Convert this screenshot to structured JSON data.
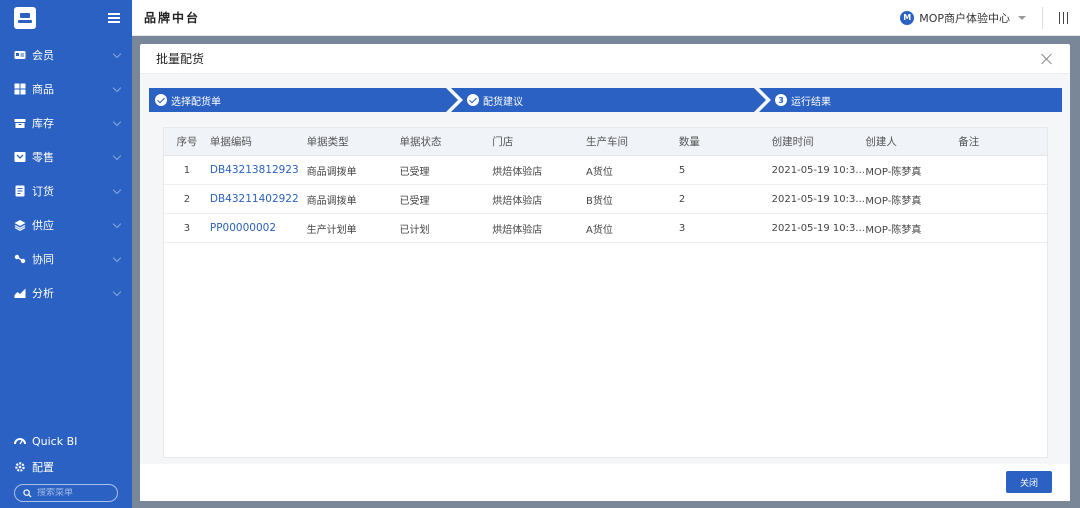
{
  "colors": {
    "primary": "#2a61c2",
    "overlay": "#7a8799"
  },
  "sidebar": {
    "logo_icon": "brand-logo-icon",
    "items": [
      {
        "label": "会员",
        "icon": "member-card-icon"
      },
      {
        "label": "商品",
        "icon": "product-grid-icon"
      },
      {
        "label": "库存",
        "icon": "inventory-icon"
      },
      {
        "label": "零售",
        "icon": "retail-icon"
      },
      {
        "label": "订货",
        "icon": "order-icon"
      },
      {
        "label": "供应",
        "icon": "supply-layers-icon"
      },
      {
        "label": "协同",
        "icon": "collaboration-icon"
      },
      {
        "label": "分析",
        "icon": "analytics-chart-icon"
      }
    ],
    "quickbi_label": "Quick BI",
    "config_label": "配置",
    "search_placeholder": "搜索菜单"
  },
  "header": {
    "title": "品牌中台",
    "tenant_initial": "M",
    "tenant_name": "MOP商户体验中心"
  },
  "modal": {
    "title": "批量配货",
    "steps": [
      {
        "label": "选择配货单",
        "state": "done"
      },
      {
        "label": "配货建议",
        "state": "done"
      },
      {
        "label": "运行结果",
        "state": "current",
        "num": "3"
      }
    ],
    "table": {
      "columns": [
        "序号",
        "单据编码",
        "单据类型",
        "单据状态",
        "门店",
        "生产车间",
        "数量",
        "创建时间",
        "创建人",
        "备注"
      ],
      "rows": [
        {
          "seq": "1",
          "code": "DB43213812923",
          "type": "商品调拨单",
          "status": "已受理",
          "store": "烘焙体验店",
          "workshop": "A货位",
          "qty": "5",
          "time": "2021-05-19 10:3...",
          "by": "MOP-陈梦真",
          "note": ""
        },
        {
          "seq": "2",
          "code": "DB43211402922",
          "type": "商品调拨单",
          "status": "已受理",
          "store": "烘焙体验店",
          "workshop": "B货位",
          "qty": "2",
          "time": "2021-05-19 10:3...",
          "by": "MOP-陈梦真",
          "note": ""
        },
        {
          "seq": "3",
          "code": "PP00000002",
          "type": "生产计划单",
          "status": "已计划",
          "store": "烘焙体验店",
          "workshop": "A货位",
          "qty": "3",
          "time": "2021-05-19 10:3...",
          "by": "MOP-陈梦真",
          "note": ""
        }
      ]
    },
    "close_button": "关闭"
  }
}
